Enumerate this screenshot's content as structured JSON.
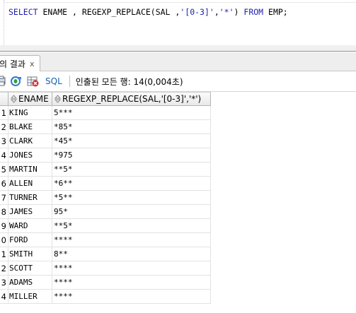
{
  "editor": {
    "sql_tokens": [
      {
        "text": "SELECT",
        "type": "kw"
      },
      {
        "text": " ENAME , REGEXP_REPLACE(SAL ,",
        "type": "id"
      },
      {
        "text": "'[0-3]'",
        "type": "str"
      },
      {
        "text": ",",
        "type": "id"
      },
      {
        "text": "'*'",
        "type": "str"
      },
      {
        "text": ") ",
        "type": "id"
      },
      {
        "text": "FROM",
        "type": "kw"
      },
      {
        "text": " EMP;",
        "type": "id"
      }
    ]
  },
  "result_tab": {
    "label": "의 결과",
    "close": "x"
  },
  "toolbar": {
    "sql_label": "SQL",
    "separator": "|",
    "status": "인출된 모든 행: 14(0,004초)"
  },
  "grid": {
    "columns": [
      "ENAME",
      "REGEXP_REPLACE(SAL,'[0-3]','*')"
    ],
    "rows": [
      {
        "n": "1",
        "ename": "KING",
        "val": "5***"
      },
      {
        "n": "2",
        "ename": "BLAKE",
        "val": "*85*"
      },
      {
        "n": "3",
        "ename": "CLARK",
        "val": "*45*"
      },
      {
        "n": "4",
        "ename": "JONES",
        "val": "*975"
      },
      {
        "n": "5",
        "ename": "MARTIN",
        "val": "**5*"
      },
      {
        "n": "6",
        "ename": "ALLEN",
        "val": "*6**"
      },
      {
        "n": "7",
        "ename": "TURNER",
        "val": "*5**"
      },
      {
        "n": "8",
        "ename": "JAMES",
        "val": "95*"
      },
      {
        "n": "9",
        "ename": "WARD",
        "val": "**5*"
      },
      {
        "n": "0",
        "ename": "FORD",
        "val": "****"
      },
      {
        "n": "1",
        "ename": "SMITH",
        "val": "8**"
      },
      {
        "n": "2",
        "ename": "SCOTT",
        "val": "****"
      },
      {
        "n": "3",
        "ename": "ADAMS",
        "val": "****"
      },
      {
        "n": "4",
        "ename": "MILLER",
        "val": "****"
      }
    ]
  },
  "icons": {
    "print": "print-icon",
    "refresh": "refresh-icon",
    "sql": "sql-icon",
    "sort": "sort-icon",
    "close": "close-icon"
  },
  "colors": {
    "keyword": "#1f1fb0",
    "sql_label": "#1560b5"
  }
}
